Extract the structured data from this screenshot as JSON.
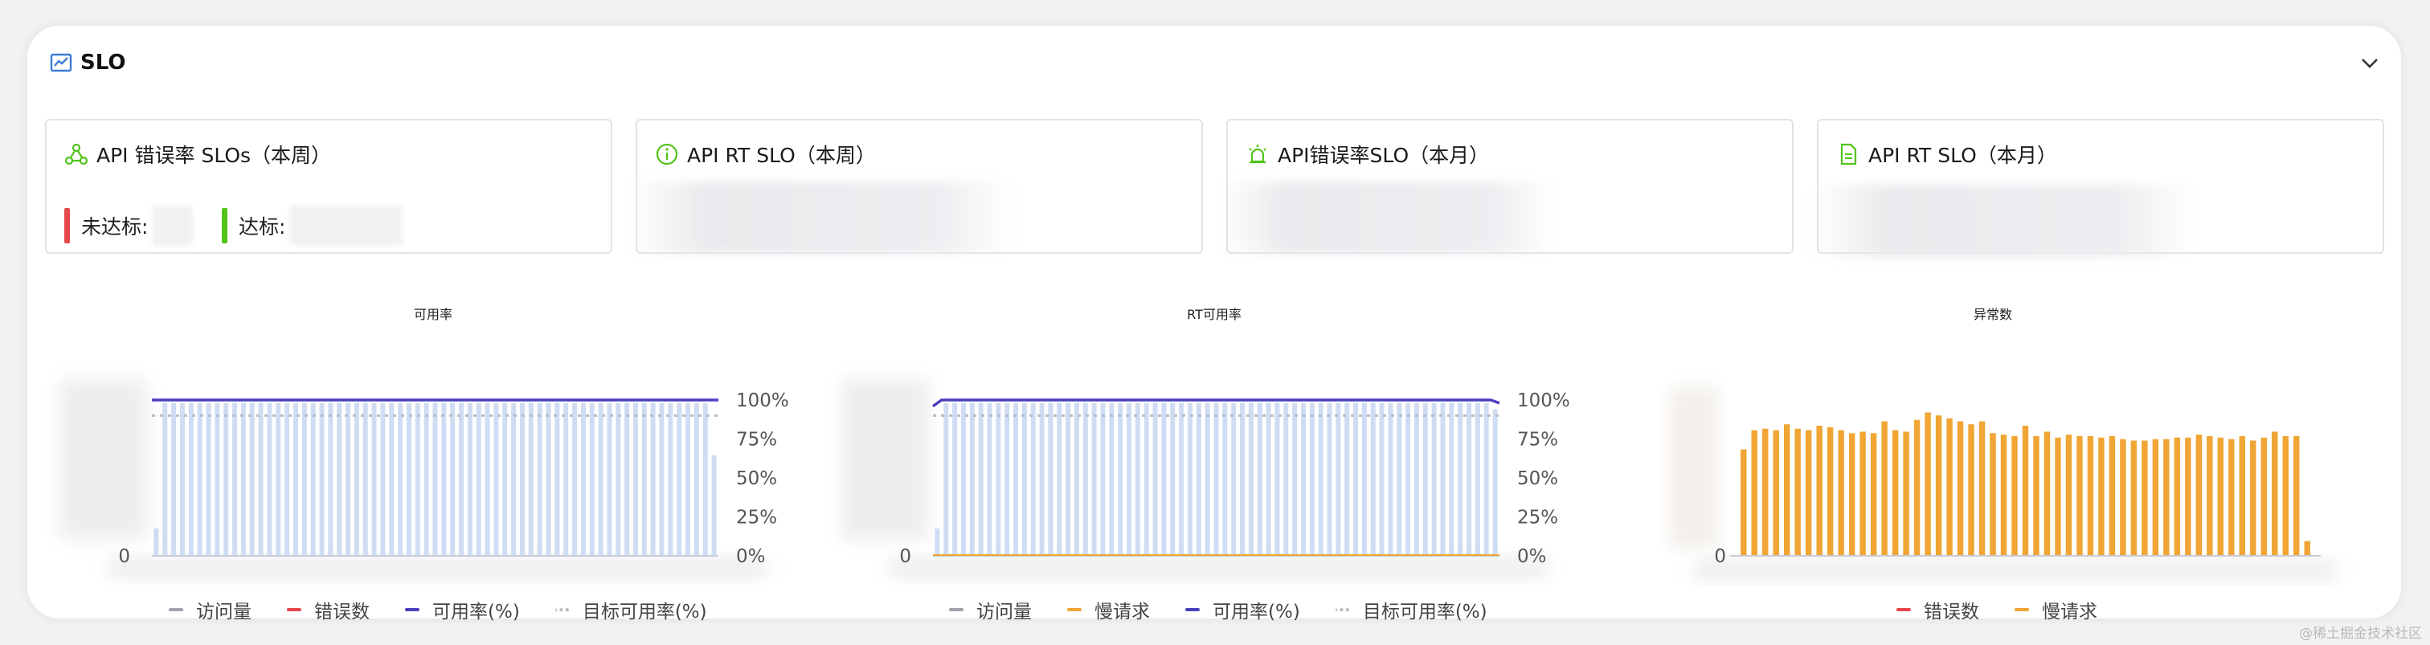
{
  "panel": {
    "title": "SLO"
  },
  "cards": [
    {
      "title": "API 错误率 SLOs（本周）",
      "icon": "hub-icon"
    },
    {
      "title": "API RT SLO（本周）",
      "icon": "info-icon"
    },
    {
      "title": "API错误率SLO（本月）",
      "icon": "alarm-icon"
    },
    {
      "title": "API RT SLO（本月）",
      "icon": "document-icon"
    }
  ],
  "stats": {
    "missed_label": "未达标:",
    "met_label": "达标:"
  },
  "colors": {
    "green_icon": "#52c41a",
    "missed": "#e5484d",
    "met": "#52c41a",
    "bar_light": "#cfdcf4",
    "line_purple": "#4b3fbf",
    "target_dotted": "#b9bcc3",
    "error": "#e5484d",
    "slow": "#f0a534",
    "visits": "#9ea2aa"
  },
  "chart_data": [
    {
      "type": "bar",
      "title": "可用率",
      "y_right_ticks": [
        "100%",
        "75%",
        "50%",
        "25%",
        "0%"
      ],
      "y_left_ticks": [
        "0"
      ],
      "series": [
        {
          "name": "访问量",
          "kind": "bar",
          "values": [
            18,
            100,
            100,
            100,
            100,
            100,
            100,
            100,
            100,
            100,
            100,
            100,
            100,
            100,
            100,
            100,
            100,
            100,
            100,
            100,
            100,
            100,
            100,
            100,
            100,
            100,
            100,
            100,
            100,
            100,
            100,
            100,
            100,
            100,
            100,
            100,
            100,
            100,
            100,
            100,
            100,
            100,
            100,
            100,
            100,
            100,
            100,
            100,
            100,
            100,
            100,
            100,
            100,
            100,
            100,
            100,
            100,
            100,
            100,
            100,
            100,
            100,
            100,
            100,
            66
          ]
        },
        {
          "name": "错误数",
          "kind": "line",
          "values": []
        },
        {
          "name": "可用率(%)",
          "kind": "line",
          "values": [
            100
          ]
        },
        {
          "name": "目标可用率(%)",
          "kind": "dotted",
          "values": [
            90
          ]
        }
      ]
    },
    {
      "type": "bar",
      "title": "RT可用率",
      "y_right_ticks": [
        "100%",
        "75%",
        "50%",
        "25%",
        "0%"
      ],
      "y_left_ticks": [
        "0"
      ],
      "series": [
        {
          "name": "访问量",
          "kind": "bar",
          "values": [
            18,
            100,
            100,
            100,
            100,
            100,
            100,
            100,
            100,
            100,
            100,
            100,
            100,
            100,
            100,
            100,
            100,
            100,
            100,
            100,
            100,
            100,
            100,
            100,
            100,
            100,
            100,
            100,
            100,
            100,
            100,
            100,
            100,
            100,
            100,
            100,
            100,
            100,
            100,
            100,
            100,
            100,
            100,
            100,
            100,
            100,
            100,
            100,
            100,
            100,
            100,
            100,
            100,
            100,
            100,
            100,
            100,
            100,
            100,
            100,
            100,
            100,
            100,
            100,
            96
          ]
        },
        {
          "name": "慢请求",
          "kind": "line",
          "values": [
            0
          ]
        },
        {
          "name": "可用率(%)",
          "kind": "line",
          "values": [
            96,
            100,
            100,
            100,
            100,
            100,
            100,
            100,
            100,
            100,
            100,
            100,
            100,
            100,
            100,
            100,
            100,
            100,
            100,
            100,
            100,
            100,
            100,
            100,
            100,
            100,
            100,
            100,
            100,
            100,
            100,
            100,
            100,
            100,
            100,
            100,
            100,
            100,
            100,
            100,
            100,
            100,
            100,
            100,
            100,
            100,
            100,
            100,
            100,
            100,
            100,
            100,
            100,
            100,
            100,
            100,
            100,
            100,
            100,
            100,
            100,
            100,
            100,
            100,
            100,
            100,
            98
          ]
        },
        {
          "name": "目标可用率(%)",
          "kind": "dotted",
          "values": [
            90
          ]
        }
      ]
    },
    {
      "type": "bar",
      "title": "异常数",
      "y_left_ticks": [
        "0"
      ],
      "series": [
        {
          "name": "错误数",
          "kind": "line",
          "values": []
        },
        {
          "name": "慢请求",
          "kind": "bar",
          "values": [
            72,
            85,
            86,
            85,
            89,
            86,
            85,
            88,
            87,
            85,
            83,
            84,
            83,
            91,
            85,
            84,
            92,
            97,
            95,
            93,
            91,
            89,
            91,
            83,
            82,
            81,
            88,
            81,
            84,
            80,
            82,
            81,
            81,
            80,
            81,
            79,
            78,
            78,
            79,
            79,
            80,
            80,
            82,
            81,
            80,
            79,
            81,
            78,
            80,
            84,
            81,
            81,
            10
          ]
        }
      ]
    }
  ],
  "watermark": "@稀土掘金技术社区"
}
